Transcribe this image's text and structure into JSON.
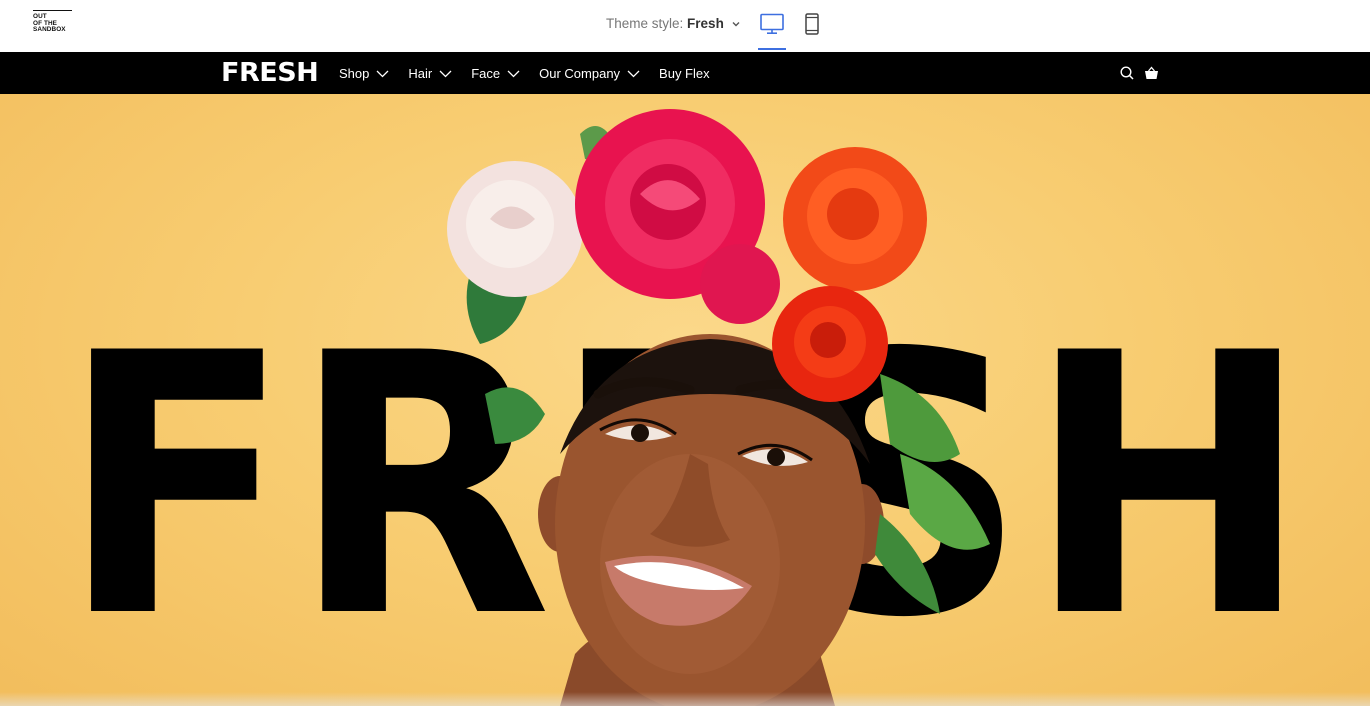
{
  "preview": {
    "logo_lines": [
      "OUT",
      "OF THE",
      "SANDBOX"
    ],
    "theme_label": "Theme style:",
    "theme_name": "Fresh",
    "devices": [
      {
        "icon": "desktop-icon",
        "active": true
      },
      {
        "icon": "mobile-icon",
        "active": false
      }
    ]
  },
  "store": {
    "brand": "FRESH",
    "nav": [
      {
        "label": "Shop",
        "has_dropdown": true
      },
      {
        "label": "Hair",
        "has_dropdown": true
      },
      {
        "label": "Face",
        "has_dropdown": true
      },
      {
        "label": "Our Company",
        "has_dropdown": true
      },
      {
        "label": "Buy Flex",
        "has_dropdown": false
      }
    ],
    "icons": [
      "search-icon",
      "basket-icon"
    ]
  },
  "hero": {
    "word": "FRESH",
    "background_color": "#f8cd72",
    "text_color": "#000000"
  },
  "colors": {
    "accent": "#3d6fe0",
    "nav_background": "#000000"
  }
}
